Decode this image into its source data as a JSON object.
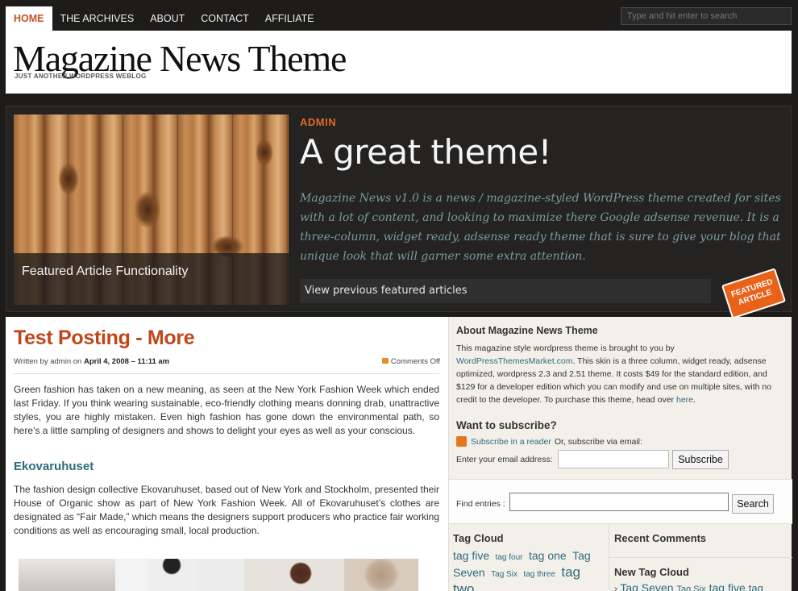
{
  "nav": {
    "items": [
      "HOME",
      "THE ARCHIVES",
      "ABOUT",
      "CONTACT",
      "AFFILIATE"
    ],
    "search_placeholder": "Type and hit enter to search"
  },
  "header": {
    "title": "Magazine News Theme",
    "tagline": "JUST ANOTHER WORDPRESS WEBLOG"
  },
  "featured": {
    "image_caption": "Featured Article Functionality",
    "author": "ADMIN",
    "title": "A great theme!",
    "excerpt": "Magazine News v1.0 is a news / magazine-styled WordPress theme created for sites with a lot of content, and looking to maximize there Google adsense revenue. It is a three-column, widget ready, adsense ready theme that is sure to give your blog that unique look that will garner some extra attention.",
    "previous_link": "View previous featured articles",
    "badge_line1": "FEATURED",
    "badge_line2": "ARTICLE"
  },
  "post": {
    "title": "Test Posting - More",
    "meta_prefix": "Written by admin on",
    "meta_date": "April 4, 2008 – 11:11 am",
    "comments": "Comments Off",
    "para1": "Green fashion has taken on a new meaning, as seen at the New York Fashion Week which ended last Friday. If you think wearing sustainable, eco-friendly clothing means donning drab, unattractive styles, you are highly mistaken. Even high fashion has gone down the environmental path, so here’s a little sampling of designers and shows to delight your eyes as well as your conscious.",
    "subheading": "Ekovaruhuset",
    "para2": "The fashion design collective Ekovaruhuset, based out of New York and Stockholm, presented their House of Organic show as part of New York Fashion Week. All of Ekovaruhuset’s clothes are designated as “Fair Made,” which means the designers support producers who practice fair working conditions as well as encouraging small, local production."
  },
  "sidebar": {
    "about_title": "About Magazine News Theme",
    "about_text_before_link": "This magazine style wordpress theme is brought to you by",
    "about_link": "WordPressThemesMarket.com",
    "about_text_after_link": ". This skin is a three column, widget ready, adsense optimized, wordpress 2.3 and 2.51 theme. It costs $49 for the standard edition, and $129 for a developer edition which you can modify and use on multiple sites, with no credit to the developer. To purchase this theme, head over",
    "about_here": "here",
    "about_end": ".",
    "subscribe_title": "Want to subscribe?",
    "rss_link": "Subscribe in a reader",
    "rss_suffix": "Or, subscribe via email:",
    "email_label": "Enter your email address:",
    "subscribe_button": "Subscribe",
    "find_label": "Find entries :",
    "search_button": "Search",
    "tag_cloud_title": "Tag Cloud",
    "tags": [
      "tag five",
      "tag four",
      "tag one",
      "Tag Seven",
      "Tag Six",
      "tag three",
      "tag two"
    ],
    "recent_comments_title": "Recent Comments",
    "new_tag_cloud_title": "New Tag Cloud",
    "new_tags": [
      "Tag Seven",
      "Tag Six",
      "tag five",
      "tag"
    ]
  },
  "colors": {
    "accent": "#c2451a",
    "link": "#2c6b7c",
    "background": "#1d1c1b"
  }
}
